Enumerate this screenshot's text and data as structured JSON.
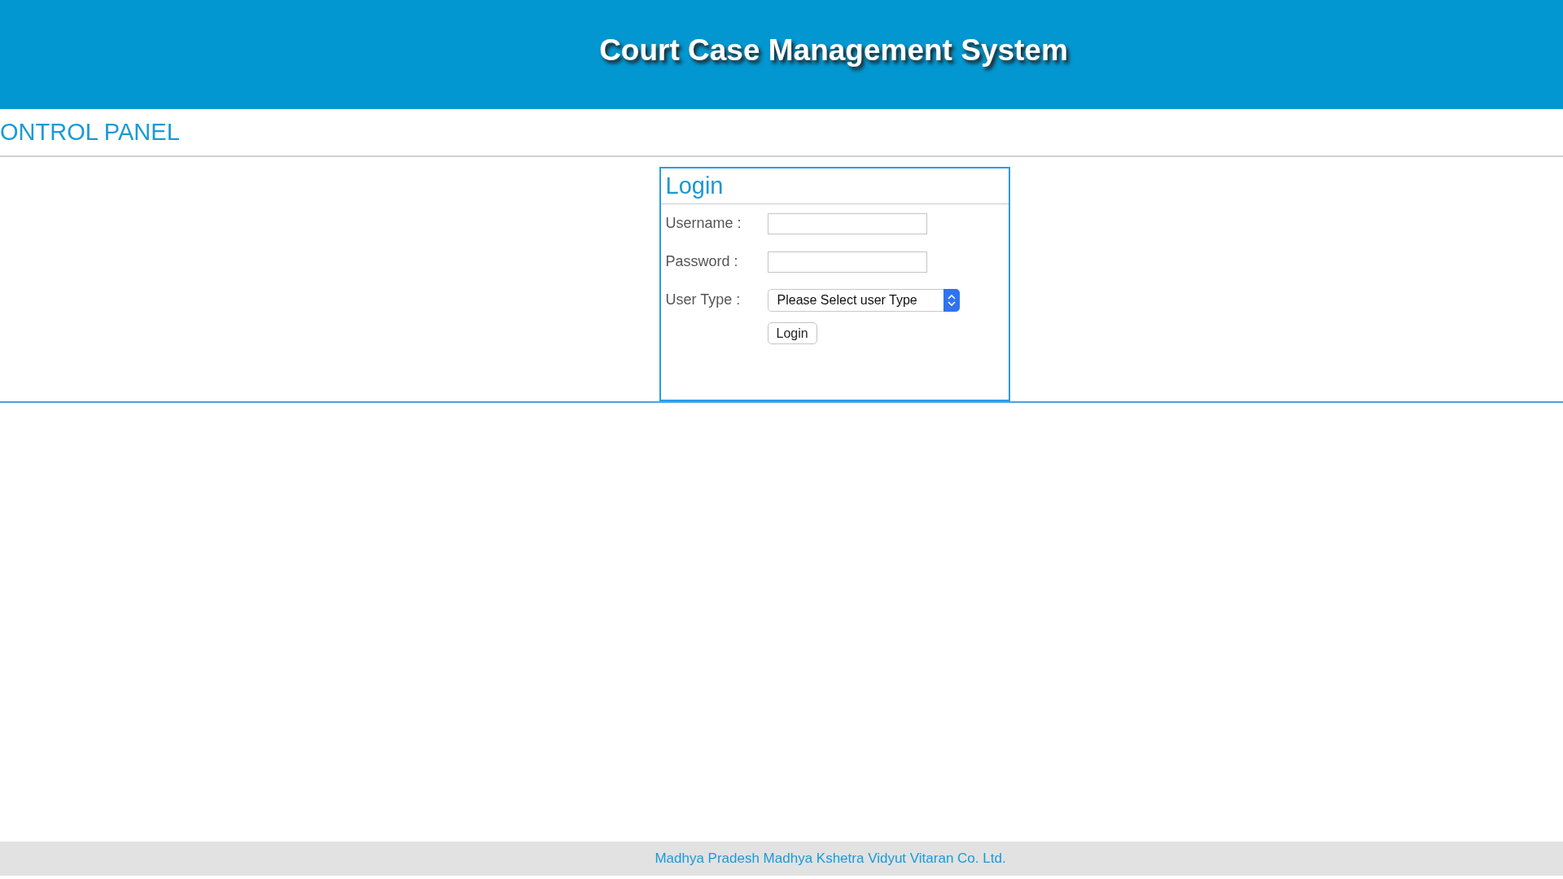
{
  "header": {
    "title": "Court Case Management System"
  },
  "section_title": "ONTROL PANEL",
  "login": {
    "title": "Login",
    "fields": [
      {
        "kind": "text",
        "label": "Username :"
      },
      {
        "kind": "password",
        "label": "Password :"
      },
      {
        "kind": "select",
        "label": "User Type :",
        "value": "Please Select user Type"
      }
    ],
    "button": "Login"
  },
  "footer": "Madhya Pradesh Madhya Kshetra Vidyut Vitaran Co. Ltd."
}
